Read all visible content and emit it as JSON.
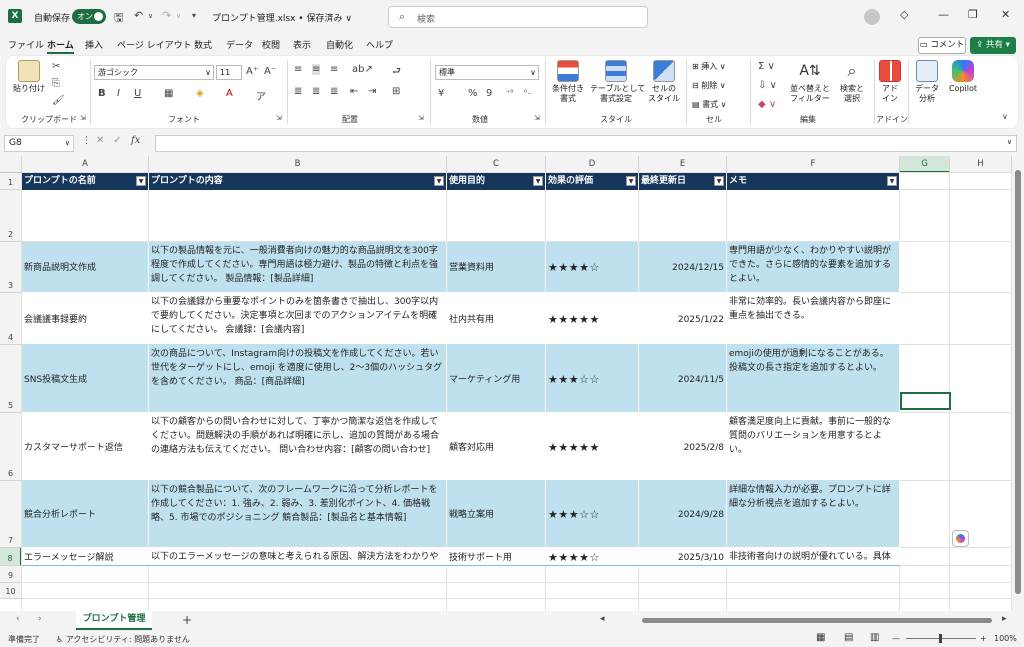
{
  "titlebar": {
    "autosave_label": "自動保存",
    "autosave_state": "オン",
    "filename": "プロンプト管理.xlsx • 保存済み ∨",
    "search_placeholder": "検索"
  },
  "menu": [
    "ファイル",
    "ホーム",
    "挿入",
    "ページ レイアウト",
    "数式",
    "データ",
    "校閲",
    "表示",
    "自動化",
    "ヘルプ"
  ],
  "menu_active": "ホーム",
  "comment_label": "コメント",
  "share_label": "共有",
  "ribbon": {
    "paste": "貼り付け",
    "font_name": "游ゴシック",
    "font_size": "11",
    "number_format": "標準",
    "cond_format": "条件付き\n書式",
    "table_format": "テーブルとして\n書式設定",
    "cell_style": "セルの\nスタイル",
    "insert": "挿入",
    "delete": "削除",
    "format": "書式",
    "sort_filter": "並べ替えと\nフィルター",
    "find_select": "検索と\n選択",
    "addin": "アド\nイン",
    "data_analysis": "データ\n分析",
    "copilot": "Copilot",
    "groups": [
      "クリップボード",
      "フォント",
      "配置",
      "数値",
      "スタイル",
      "セル",
      "編集",
      "アドイン"
    ]
  },
  "namebox": "G8",
  "fx": "fx",
  "columns": [
    "A",
    "B",
    "C",
    "D",
    "E",
    "F",
    "G",
    "H"
  ],
  "rows": [
    "1",
    "2",
    "3",
    "4",
    "5",
    "6",
    "7",
    "8",
    "9",
    "10"
  ],
  "table": {
    "headers": [
      "プロンプトの名前",
      "プロンプトの内容",
      "使用目的",
      "効果の評価",
      "最終更新日",
      "メモ"
    ],
    "rows": [
      {
        "name": "新商品説明文作成",
        "content": "以下の製品情報を元に、一般消費者向けの魅力的な商品説明文を300字程度で作成してください。専門用語は極力避け、製品の特徴と利点を強調してください。 製品情報：[製品詳細]",
        "purpose": "営業資料用",
        "rating": "★★★★☆",
        "date": "2024/12/15",
        "memo": "専門用語が少なく、わかりやすい説明ができた。さらに感情的な要素を追加するとよい。"
      },
      {
        "name": "会議議事録要約",
        "content": "以下の会議録から重要なポイントのみを箇条書きで抽出し、300字以内で要約してください。決定事項と次回までのアクションアイテムを明確にしてください。 会議録：[会議内容]",
        "purpose": "社内共有用",
        "rating": "★★★★★",
        "date": "2025/1/22",
        "memo": "非常に効率的。長い会議内容から即座に重点を抽出できる。"
      },
      {
        "name": "SNS投稿文生成",
        "content": "次の商品について、Instagram向けの投稿文を作成してください。若い世代をターゲットにし、emoji を適度に使用し、2〜3個のハッシュタグを含めてください。 商品：[商品詳細]",
        "purpose": "マーケティング用",
        "rating": "★★★☆☆",
        "date": "2024/11/5",
        "memo": "emojiの使用が過剰になることがある。投稿文の長さ指定を追加するとよい。"
      },
      {
        "name": "カスタマーサポート返信",
        "content": "以下の顧客からの問い合わせに対して、丁寧かつ簡潔な返信を作成してください。問題解決の手順があれば明確に示し、追加の質問がある場合の連絡方法も伝えてください。 問い合わせ内容：[顧客の問い合わせ]",
        "purpose": "顧客対応用",
        "rating": "★★★★★",
        "date": "2025/2/8",
        "memo": "顧客満足度向上に貢献。事前に一般的な質問のバリエーションを用意するとよい。"
      },
      {
        "name": "競合分析レポート",
        "content": "以下の競合製品について、次のフレームワークに沿って分析レポートを作成してください：1. 強み、2. 弱み、3. 差別化ポイント、4. 価格戦略、5. 市場でのポジショニング 競合製品：[製品名と基本情報]",
        "purpose": "戦略立案用",
        "rating": "★★★☆☆",
        "date": "2024/9/28",
        "memo": "詳細な情報入力が必要。プロンプトに詳細な分析視点を追加するとよい。"
      },
      {
        "name": "エラーメッセージ解説",
        "content": "以下のエラーメッセージの意味と考えられる原因、解決方法をわかりやすく説明してください。技術者ではない人にも理解できる言葉で説明してください。 エラーメッセージ：[エラー内容]",
        "purpose": "技術サポート用",
        "rating": "★★★★☆",
        "date": "2025/3/10",
        "memo": "非技術者向けの説明が優れている。具体的な例を加えるとさらに良くなる。"
      }
    ]
  },
  "sheet_tab": "プロンプト管理",
  "status": {
    "ready": "準備完了",
    "accessibility": "アクセシビリティ: 問題ありません",
    "zoom": "100%"
  }
}
